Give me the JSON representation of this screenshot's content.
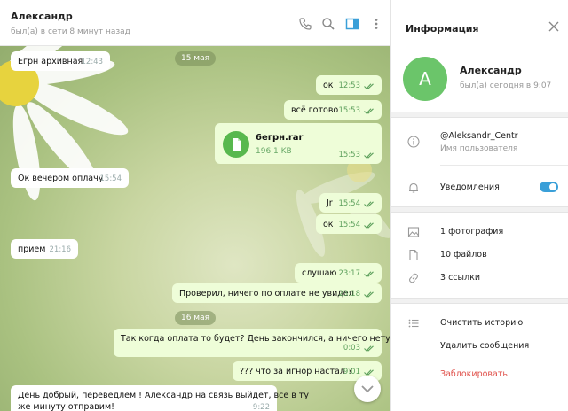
{
  "chat": {
    "contact_name": "Александр",
    "last_seen": "был(а) в сети 8 минут назад",
    "icons": [
      "phone-icon",
      "search-icon",
      "sidebar-toggle-icon",
      "more-vert-icon"
    ]
  },
  "messages": {
    "m1": {
      "text": "Егрн архивная",
      "time": "12:43"
    },
    "date1": "15 мая",
    "m2": {
      "text": "ок",
      "time": "12:53"
    },
    "m3": {
      "text": "всё готово",
      "time": "15:53"
    },
    "file": {
      "name": "6егрн.rar",
      "size": "196.1 KB",
      "time": "15:53"
    },
    "m4": {
      "text": "Ок вечером оплачу",
      "time": "15:54"
    },
    "m5": {
      "text": "Jr",
      "time": "15:54"
    },
    "m6": {
      "text": "ок",
      "time": "15:54"
    },
    "m7": {
      "text": "прием",
      "time": "21:16"
    },
    "m8": {
      "text": "слушаю",
      "time": "23:17"
    },
    "m9": {
      "text": "Проверил, ничего по оплате не увидел",
      "time": "23:18"
    },
    "date2": "16 мая",
    "m10": {
      "text": "Так когда оплата то будет? День закончился, а ничего нету",
      "time": "0:03"
    },
    "m11": {
      "text": "??? что за игнор настал ?",
      "time": "9:01"
    },
    "m12": {
      "line1": "День добрый, переведлем ! Александр на связь выйдет, все в ту",
      "line2": "же минуту отправим!",
      "time": "9:22"
    }
  },
  "info": {
    "title": "Информация",
    "avatar_letter": "А",
    "name": "Александр",
    "status": "был(а) сегодня в 9:07",
    "username": "@Aleksandr_Centr",
    "username_label": "Имя пользователя",
    "notifications_label": "Уведомления",
    "notifications_on": true,
    "photos": "1 фотография",
    "files": "10 файлов",
    "links": "3 ссылки",
    "clear_history": "Очистить историю",
    "delete_messages": "Удалить сообщения",
    "block": "Заблокировать"
  },
  "colors": {
    "accent_green": "#6bc56a",
    "outgoing_bubble": "#eefdd8",
    "toggle_blue": "#3a9fd8",
    "danger_red": "#e0514b"
  }
}
